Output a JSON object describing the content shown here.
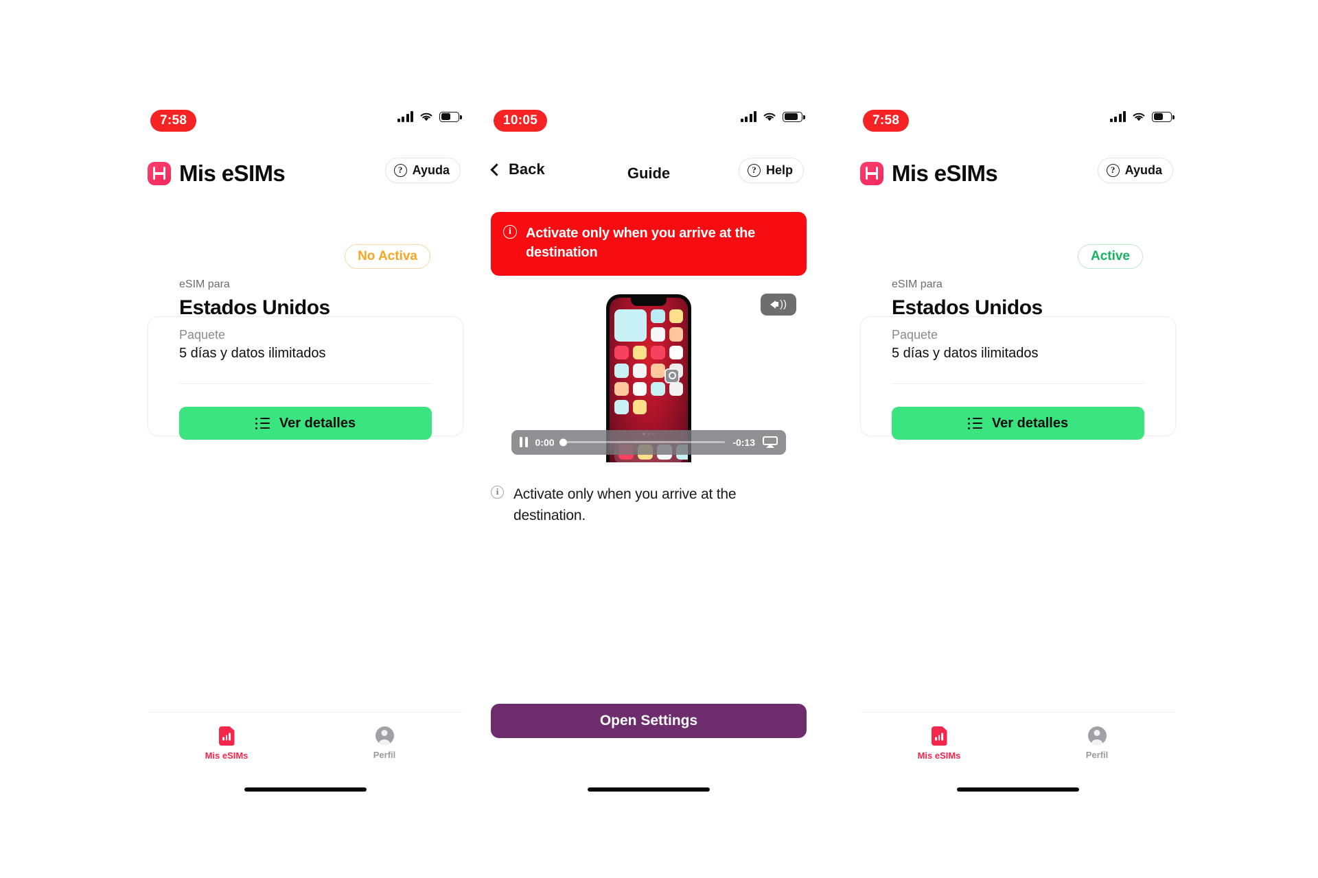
{
  "screens": [
    {
      "id": "my-esims-inactive",
      "status_bar": {
        "time": "7:58",
        "signal_icon": "cellular-bars-icon",
        "wifi_icon": "wifi-icon",
        "battery_icon": "battery-icon",
        "battery_level_pct": 55
      },
      "header": {
        "brand_icon": "holafly-logo-icon",
        "title": "Mis eSIMs",
        "help_label": "Ayuda",
        "help_icon": "question-circle-icon"
      },
      "card": {
        "status_badge": "No Activa",
        "status_badge_color": "#f5a623",
        "eyebrow": "eSIM para",
        "country": "Estados Unidos",
        "package_label": "Paquete",
        "package_value": "5 días y datos ilimitados",
        "cta_label": "Ver detalles",
        "cta_icon": "list-icon",
        "cta_color": "#3ae57f"
      },
      "tabbar": {
        "tab1_label": "Mis eSIMs",
        "tab1_icon": "sim-card-icon",
        "tab2_label": "Perfil",
        "tab2_icon": "profile-avatar-icon"
      }
    },
    {
      "id": "guide",
      "status_bar": {
        "time": "10:05",
        "signal_icon": "cellular-bars-icon",
        "wifi_icon": "wifi-icon",
        "battery_icon": "battery-icon",
        "battery_level_pct": 80
      },
      "nav": {
        "back_label": "Back",
        "back_icon": "chevron-left-icon",
        "title": "Guide",
        "help_label": "Help",
        "help_icon": "question-circle-icon"
      },
      "alert": {
        "icon": "info-circle-icon",
        "text": "Activate only when you arrive at the destination",
        "background": "#f60c11"
      },
      "video": {
        "mute_icon": "speaker-wave-icon",
        "pause_icon": "pause-icon",
        "current_time": "0:00",
        "remaining_time": "-0:13",
        "airplay_icon": "airplay-icon",
        "progress_pct": 0
      },
      "caption": {
        "icon": "info-circle-outline-icon",
        "text": "Activate only when you arrive at the destination."
      },
      "primary_button": {
        "label": "Open Settings",
        "color": "#6d2c6b"
      }
    },
    {
      "id": "my-esims-active",
      "status_bar": {
        "time": "7:58",
        "signal_icon": "cellular-bars-icon",
        "wifi_icon": "wifi-icon",
        "battery_icon": "battery-icon",
        "battery_level_pct": 55
      },
      "header": {
        "brand_icon": "holafly-logo-icon",
        "title": "Mis eSIMs",
        "help_label": "Ayuda",
        "help_icon": "question-circle-icon"
      },
      "card": {
        "status_badge": "Active",
        "status_badge_color": "#16b35e",
        "eyebrow": "eSIM para",
        "country": "Estados Unidos",
        "package_label": "Paquete",
        "package_value": "5 días y datos ilimitados",
        "cta_label": "Ver detalles",
        "cta_icon": "list-icon",
        "cta_color": "#3ae57f"
      },
      "tabbar": {
        "tab1_label": "Mis eSIMs",
        "tab1_icon": "sim-card-icon",
        "tab2_label": "Perfil",
        "tab2_icon": "profile-avatar-icon"
      }
    }
  ]
}
